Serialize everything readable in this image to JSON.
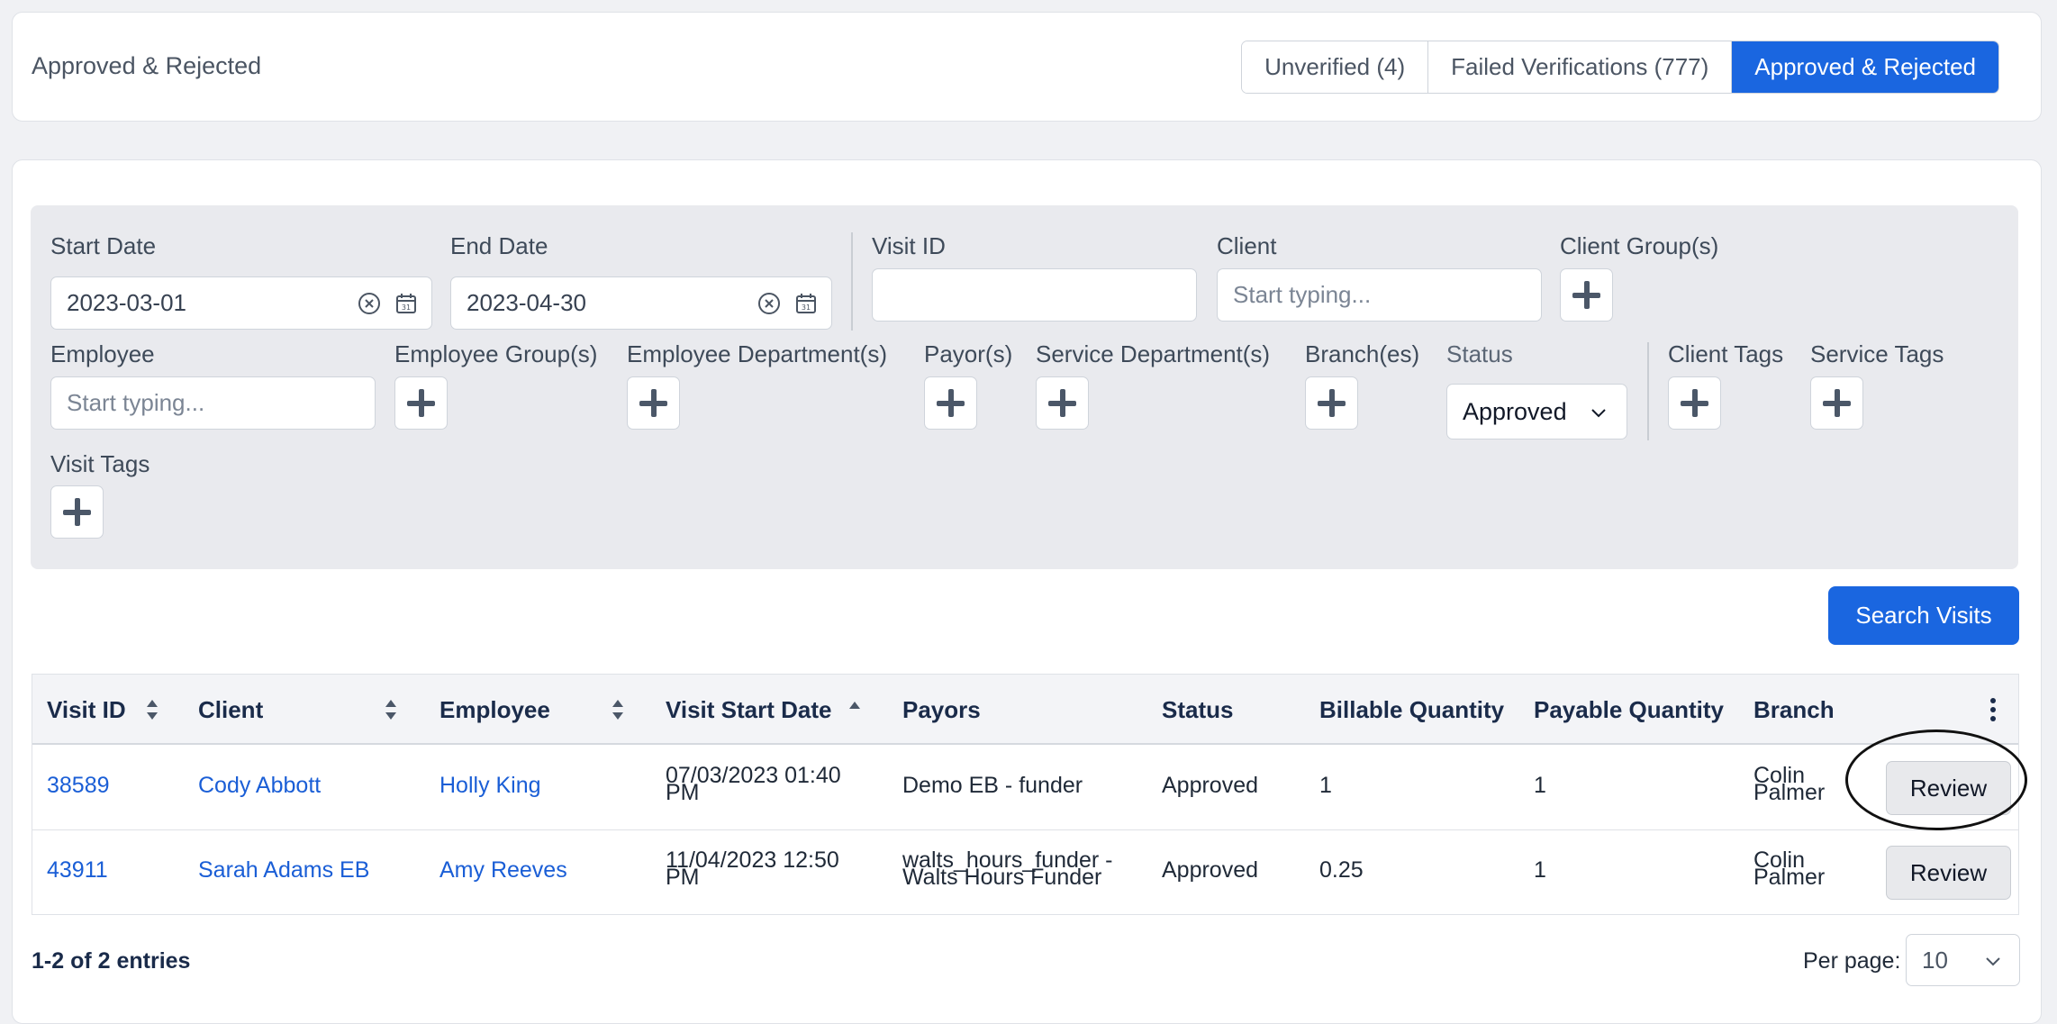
{
  "header": {
    "title": "Approved & Rejected",
    "tabs": [
      {
        "label": "Unverified (4)"
      },
      {
        "label": "Failed Verifications (777)"
      },
      {
        "label": "Approved & Rejected"
      }
    ]
  },
  "filters": {
    "start_date": {
      "label": "Start Date",
      "value": "2023-03-01"
    },
    "end_date": {
      "label": "End Date",
      "value": "2023-04-30"
    },
    "visit_id": {
      "label": "Visit ID",
      "value": ""
    },
    "client": {
      "label": "Client",
      "placeholder": "Start typing..."
    },
    "client_groups": {
      "label": "Client Group(s)"
    },
    "employee": {
      "label": "Employee",
      "placeholder": "Start typing..."
    },
    "employee_groups": {
      "label": "Employee Group(s)"
    },
    "employee_departments": {
      "label": "Employee Department(s)"
    },
    "payors": {
      "label": "Payor(s)"
    },
    "service_departments": {
      "label": "Service Department(s)"
    },
    "branches": {
      "label": "Branch(es)"
    },
    "status": {
      "label": "Status",
      "value": "Approved"
    },
    "client_tags": {
      "label": "Client Tags"
    },
    "service_tags": {
      "label": "Service Tags"
    },
    "visit_tags": {
      "label": "Visit Tags"
    }
  },
  "search_button": "Search Visits",
  "table": {
    "columns": [
      "Visit ID",
      "Client",
      "Employee",
      "Visit Start Date",
      "Payors",
      "Status",
      "Billable Quantity",
      "Payable Quantity",
      "Branch"
    ],
    "rows": [
      {
        "visit_id": "38589",
        "client": "Cody Abbott",
        "employee": "Holly King",
        "start_date_line1": "07/03/2023 01:40",
        "start_date_line2": "PM",
        "payor_line1": "Demo EB - funder",
        "payor_line2": "",
        "status": "Approved",
        "billable": "1",
        "payable": "1",
        "branch_line1": "Colin",
        "branch_line2": "Palmer",
        "action": "Review"
      },
      {
        "visit_id": "43911",
        "client": "Sarah Adams EB",
        "employee": "Amy Reeves",
        "start_date_line1": "11/04/2023 12:50",
        "start_date_line2": "PM",
        "payor_line1": "walts_hours_funder -",
        "payor_line2": "Walts Hours Funder",
        "status": "Approved",
        "billable": "0.25",
        "payable": "1",
        "branch_line1": "Colin",
        "branch_line2": "Palmer",
        "action": "Review"
      }
    ]
  },
  "footer": {
    "entries": "1-2 of 2 entries",
    "per_page_label": "Per page:",
    "per_page_value": "10"
  },
  "colors": {
    "accent": "#1a66e0",
    "link": "#1a5ed6",
    "panel": "#e9eaee"
  }
}
